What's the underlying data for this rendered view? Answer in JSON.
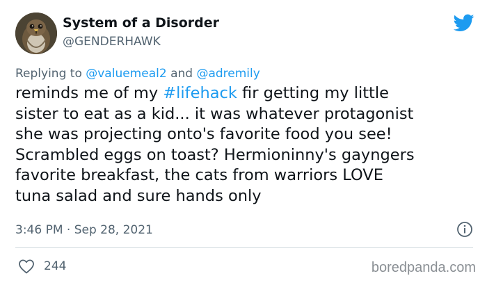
{
  "user": {
    "display_name": "System of a Disorder",
    "handle": "@GENDERHAWK"
  },
  "reply": {
    "prefix": "Replying to ",
    "mention_1": "@valuemeal2",
    "joiner": " and ",
    "mention_2": "@adremily"
  },
  "tweet": {
    "line1_before": "reminds me of my ",
    "hashtag": "#lifehack",
    "line1_after": " fir getting my little",
    "rest": "\nsister to eat as a kid... it was whatever protagonist\nshe was projecting onto's favorite food you see!\nScrambled eggs on toast? Hermioninny's gayngers\nfavorite breakfast, the cats from warriors LOVE\ntuna salad and sure hands only",
    "timestamp": "3:46 PM · Sep 28, 2021"
  },
  "engagement": {
    "likes": "244"
  },
  "watermark": "boredpanda.com",
  "icons": {
    "brand": "twitter-bird-icon",
    "info": "info-icon",
    "like": "heart-icon"
  },
  "colors": {
    "accent": "#1d9bf0",
    "secondary_text": "#536471",
    "primary_text": "#0f1419"
  }
}
